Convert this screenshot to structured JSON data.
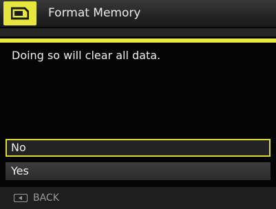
{
  "header": {
    "icon": "memory-card-icon",
    "title": "Format Memory"
  },
  "message": "Doing so will clear all data.",
  "options": [
    {
      "label": "No",
      "selected": true
    },
    {
      "label": "Yes",
      "selected": false
    }
  ],
  "footer": {
    "icon": "back-key-icon",
    "label": "BACK"
  },
  "colors": {
    "accent": "#e9e941",
    "background": "#050505",
    "text": "#f0f0f0"
  }
}
